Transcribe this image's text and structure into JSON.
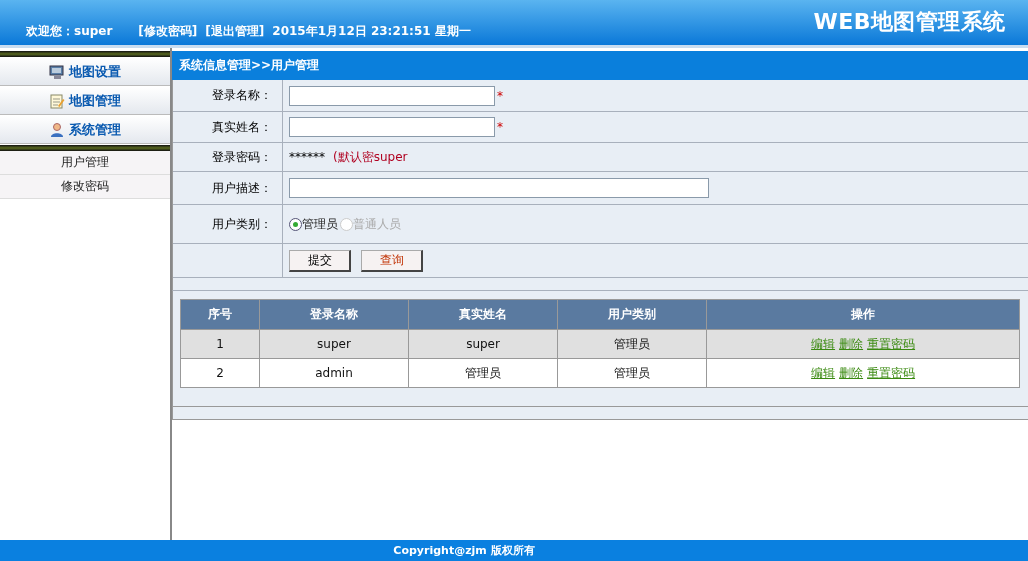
{
  "header": {
    "welcome": "欢迎您：super",
    "links": [
      "[修改密码]",
      "[退出管理]"
    ],
    "datetime": "2015年1月12日 23:21:51 星期一",
    "title": "WEB地图管理系统"
  },
  "sidebar": {
    "menus": [
      {
        "label": "地图设置"
      },
      {
        "label": "地图管理"
      },
      {
        "label": "系统管理"
      }
    ],
    "items": [
      "用户管理",
      "修改密码"
    ]
  },
  "breadcrumb": "系统信息管理>>用户管理",
  "form": {
    "rows": [
      {
        "kind": "input",
        "label": "登录名称：",
        "mark": "*",
        "wide": false
      },
      {
        "kind": "input",
        "label": "真实姓名：",
        "mark": "*",
        "wide": false
      },
      {
        "kind": "text",
        "label": "登录密码：",
        "value": "******",
        "hint": "(默认密super"
      },
      {
        "kind": "input",
        "label": "用户描述：",
        "wide": true
      },
      {
        "kind": "radio",
        "label": "用户类别：",
        "options": [
          {
            "label": "管理员",
            "selected": true,
            "disabled": false
          },
          {
            "label": "普通人员",
            "selected": false,
            "disabled": true
          }
        ]
      },
      {
        "kind": "buttons",
        "buttons": [
          "提交",
          "查询"
        ]
      }
    ]
  },
  "table": {
    "columns": [
      "序号",
      "登录名称",
      "真实姓名",
      "用户类别",
      "操作"
    ],
    "rows": [
      {
        "cells": [
          "1",
          "super",
          "super",
          "管理员"
        ],
        "actions": [
          "编辑",
          "删除",
          "重置密码"
        ]
      },
      {
        "cells": [
          "2",
          "admin",
          "管理员",
          "管理员"
        ],
        "actions": [
          "编辑",
          "删除",
          "重置密码"
        ]
      }
    ]
  },
  "footer": "Copyright@zjm 版权所有"
}
